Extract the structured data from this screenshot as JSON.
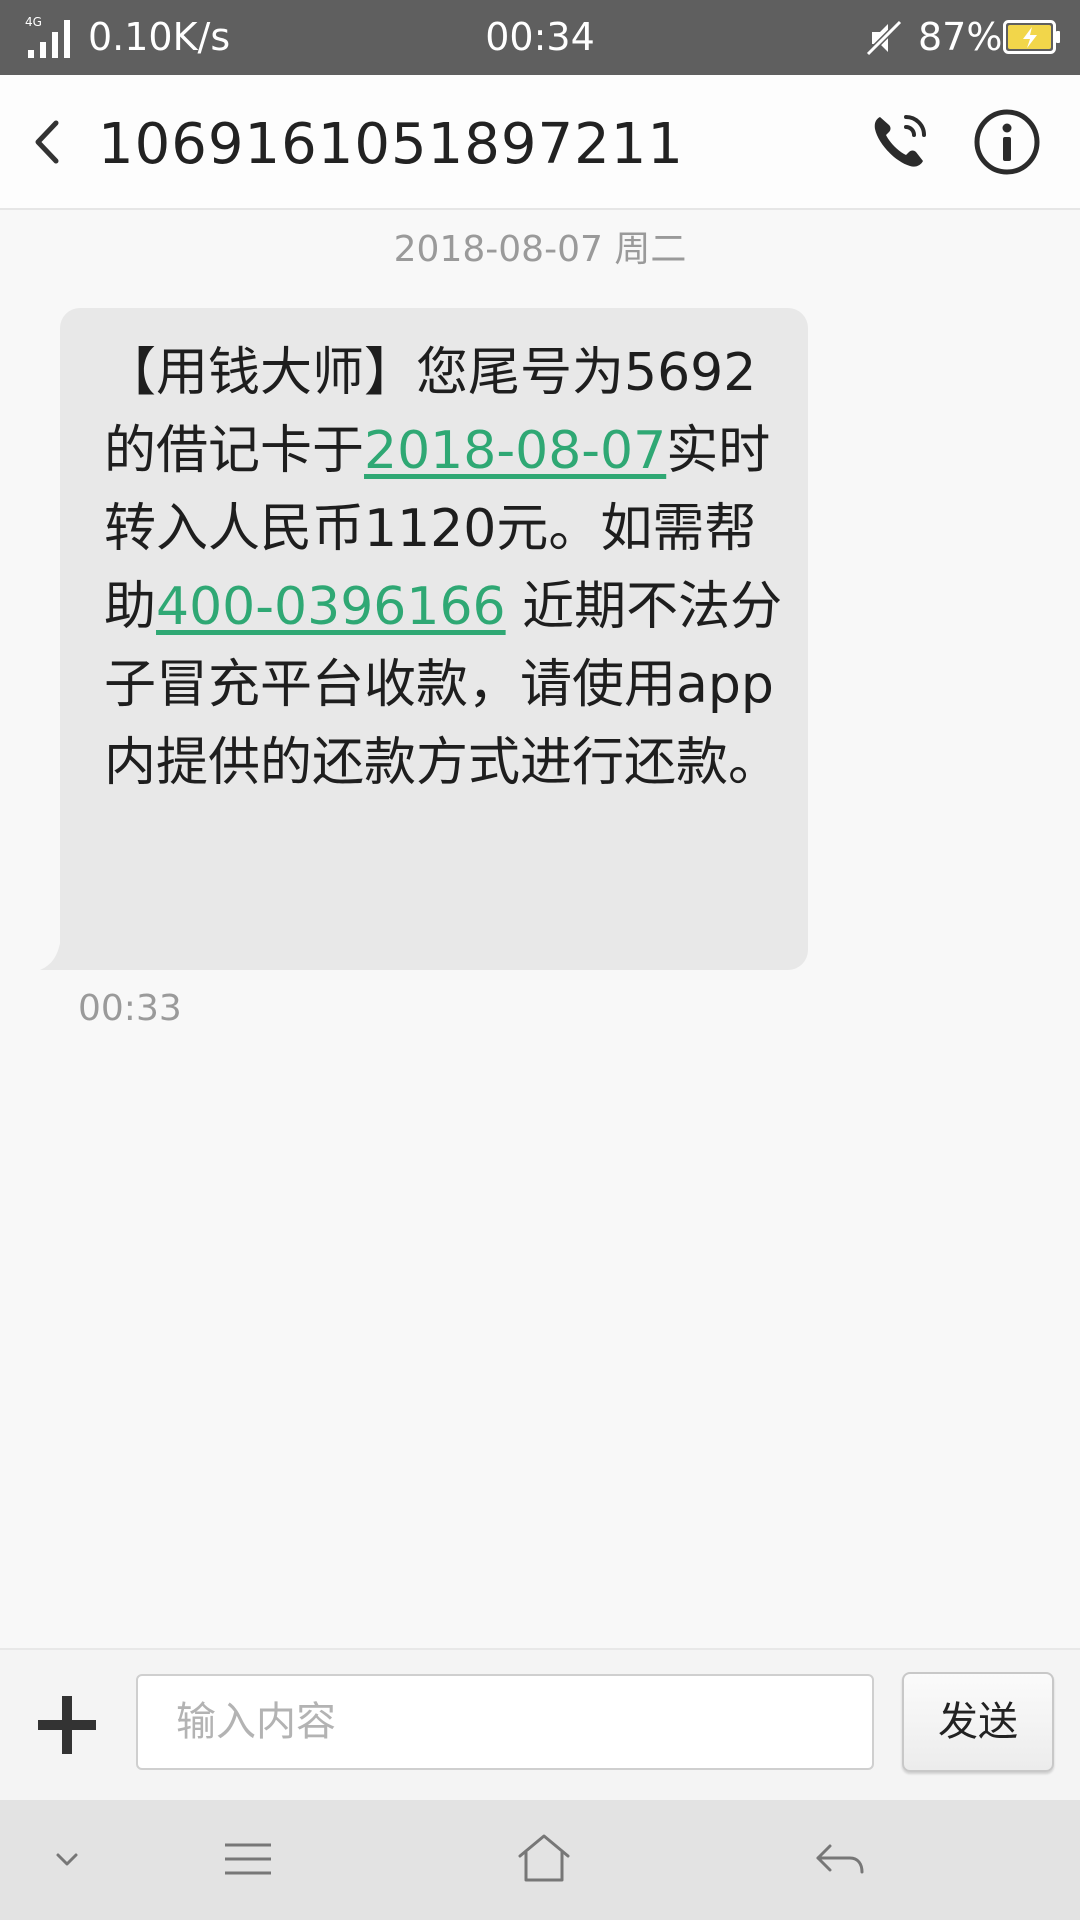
{
  "status_bar": {
    "network": "4G",
    "speed": "0.10K/s",
    "time": "00:34",
    "battery": "87%"
  },
  "header": {
    "title": "1069161051897211"
  },
  "conversation": {
    "date_separator": "2018-08-07 周二",
    "message": {
      "parts": [
        "【用钱大师】您尾号为5692的借记卡于",
        "2018-08-07",
        "实时转入人民币1120元。如需帮助",
        "400-0396166",
        " 近期不法分子冒充平台收款，请使用app内提供的还款方式进行还款。"
      ],
      "time": "00:33"
    }
  },
  "input_bar": {
    "placeholder": "输入内容",
    "send_label": "发送"
  },
  "colors": {
    "status_bar_bg": "#5f5f5f",
    "link": "#2fa874",
    "bubble": "#e8e8e8"
  },
  "icons": {
    "back": "chevron-left-icon",
    "call": "phone-icon",
    "info": "info-icon",
    "add": "plus-icon",
    "nav_collapse": "chevron-down-icon",
    "nav_menu": "menu-icon",
    "nav_home": "home-icon",
    "nav_back": "back-arrow-icon"
  }
}
